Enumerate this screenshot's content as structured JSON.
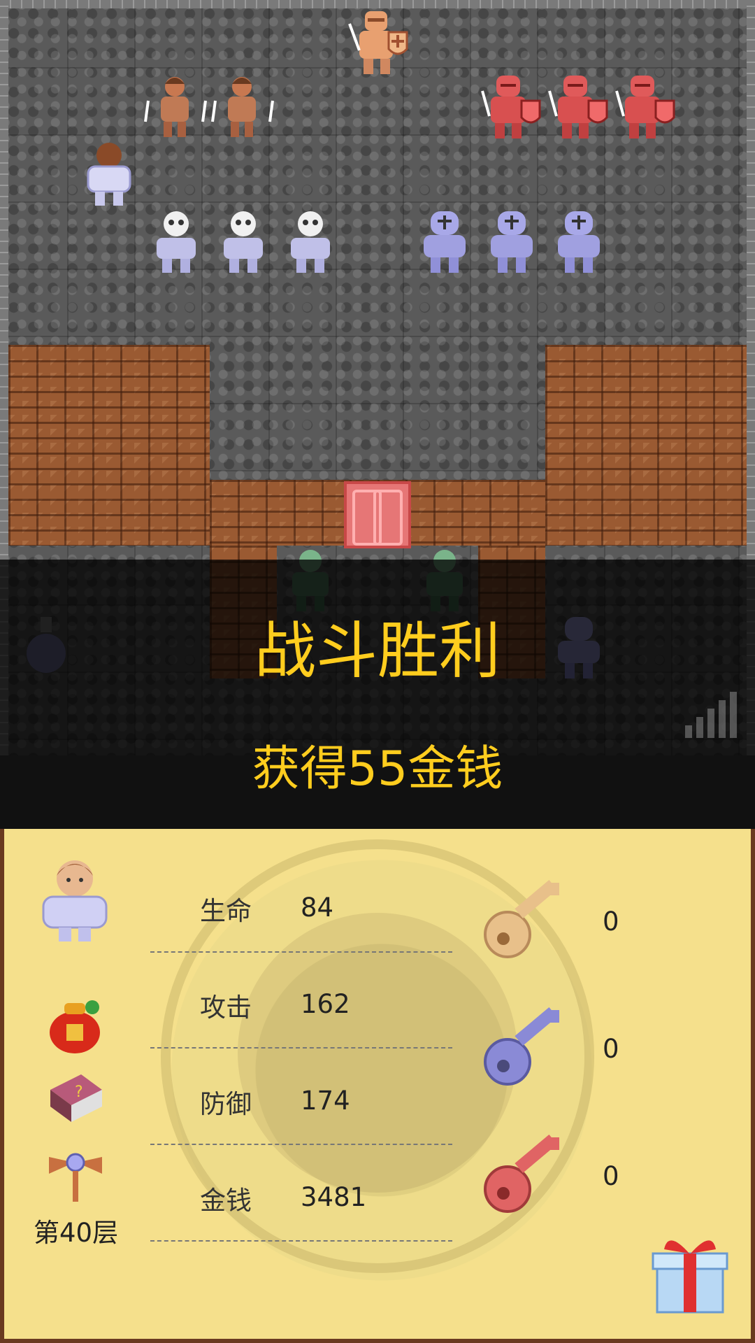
{
  "battle_result": {
    "title": "战斗胜利",
    "reward": "获得55金钱"
  },
  "stats": [
    {
      "label": "生命",
      "value": "84"
    },
    {
      "label": "攻击",
      "value": "162"
    },
    {
      "label": "防御",
      "value": "174"
    },
    {
      "label": "金钱",
      "value": "3481"
    }
  ],
  "keys": [
    {
      "name": "yellow-key",
      "count": "0",
      "color": "#e8c08a"
    },
    {
      "name": "blue-key",
      "count": "0",
      "color": "#8a8ad6"
    },
    {
      "name": "red-key",
      "count": "0",
      "color": "#e06464"
    }
  ],
  "floor": {
    "label": "第40层"
  },
  "icons": {
    "hero": "hero-portrait-icon",
    "bag": "lucky-bag-icon",
    "book": "monster-book-icon",
    "fly": "floor-fly-icon",
    "gift": "gift-box-icon"
  },
  "colors": {
    "victory_text": "#ffcd1e",
    "panel_bg": "#f5e08c",
    "brick": "#9a5a32",
    "stone": "#5a5a5a"
  }
}
